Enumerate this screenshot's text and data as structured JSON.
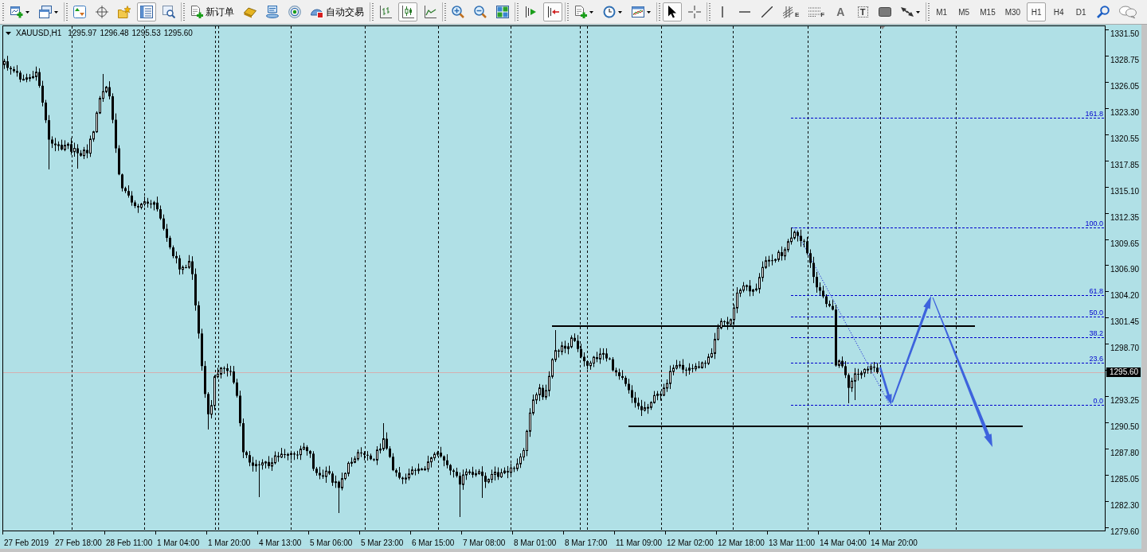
{
  "toolbar": {
    "groups": [
      [
        {
          "kind": "new-chart",
          "pressed": false,
          "dropdown": true
        },
        {
          "kind": "profiles",
          "pressed": false,
          "dropdown": true
        }
      ],
      [
        {
          "kind": "market-watch",
          "pressed": false
        },
        {
          "kind": "data-window",
          "pressed": false
        },
        {
          "kind": "navigator",
          "pressed": false
        },
        {
          "kind": "terminal",
          "pressed": true
        },
        {
          "kind": "tester",
          "pressed": false
        }
      ],
      [
        {
          "kind": "new-order",
          "pressed": false,
          "label": "新订单"
        },
        {
          "kind": "editor",
          "pressed": false
        },
        {
          "kind": "community",
          "pressed": false
        },
        {
          "kind": "signals",
          "pressed": false
        },
        {
          "kind": "auto-trading",
          "pressed": false,
          "label": "自动交易"
        }
      ],
      [
        {
          "kind": "bar-chart",
          "pressed": false
        },
        {
          "kind": "candlestick-chart",
          "pressed": true
        },
        {
          "kind": "line-chart",
          "pressed": false
        }
      ],
      [
        {
          "kind": "zoom-in",
          "pressed": false
        },
        {
          "kind": "zoom-out",
          "pressed": false
        },
        {
          "kind": "tile-windows",
          "pressed": false
        }
      ],
      [
        {
          "kind": "chart-shift",
          "pressed": false
        },
        {
          "kind": "autoscroll",
          "pressed": true
        }
      ],
      [
        {
          "kind": "indicators",
          "pressed": false,
          "dropdown": true
        },
        {
          "kind": "periods",
          "pressed": false,
          "dropdown": true
        },
        {
          "kind": "templates",
          "pressed": false,
          "dropdown": true
        }
      ],
      [
        {
          "kind": "cursor",
          "pressed": true
        },
        {
          "kind": "crosshair",
          "pressed": false
        }
      ],
      [
        {
          "kind": "vertical-line",
          "pressed": false
        },
        {
          "kind": "horizontal-line",
          "pressed": false
        },
        {
          "kind": "trend-line",
          "pressed": false
        },
        {
          "kind": "channel",
          "pressed": false,
          "glyph": "E"
        },
        {
          "kind": "fibonacci",
          "pressed": false,
          "glyph": "F"
        },
        {
          "kind": "text",
          "pressed": false,
          "glyph": "A"
        },
        {
          "kind": "text-label",
          "pressed": false,
          "glyph": "T"
        },
        {
          "kind": "rectangle",
          "pressed": false
        },
        {
          "kind": "arrows",
          "pressed": false,
          "dropdown": true
        }
      ]
    ],
    "timeframes": [
      {
        "label": "M1",
        "selected": false
      },
      {
        "label": "M5",
        "selected": false
      },
      {
        "label": "M15",
        "selected": false
      },
      {
        "label": "M30",
        "selected": false
      },
      {
        "label": "H1",
        "selected": true
      },
      {
        "label": "H4",
        "selected": false
      },
      {
        "label": "D1",
        "selected": false
      }
    ],
    "extras": [
      {
        "kind": "search",
        "pressed": false
      },
      {
        "kind": "chat",
        "pressed": false
      }
    ]
  },
  "chart": {
    "symbol": "XAUUSD,H1",
    "ohlc": [
      "1295.97",
      "1296.48",
      "1295.53",
      "1295.60"
    ],
    "fib_levels": [
      "161.8",
      "100.0",
      "61.8",
      "50.0",
      "38.2",
      "23.6",
      "0.0"
    ],
    "price_ticks": [
      "1331.50",
      "1328.75",
      "1326.05",
      "1323.30",
      "1320.55",
      "1317.85",
      "1315.10",
      "1312.35",
      "1309.65",
      "1306.90",
      "1304.20",
      "1301.45",
      "1298.70",
      "1293.25",
      "1290.50",
      "1287.80",
      "1285.05",
      "1282.30",
      "1279.60"
    ],
    "current_price": "1295.60",
    "time_labels": [
      "27 Feb 2019",
      "27 Feb 18:00",
      "28 Feb 11:00",
      "1 Mar 04:00",
      "1 Mar 20:00",
      "4 Mar 13:00",
      "5 Mar 06:00",
      "5 Mar 23:00",
      "6 Mar 15:00",
      "7 Mar 08:00",
      "8 Mar 01:00",
      "8 Mar 17:00",
      "11 Mar 09:00",
      "12 Mar 02:00",
      "12 Mar 18:00",
      "13 Mar 11:00",
      "14 Mar 04:00",
      "14 Mar 20:00"
    ]
  }
}
